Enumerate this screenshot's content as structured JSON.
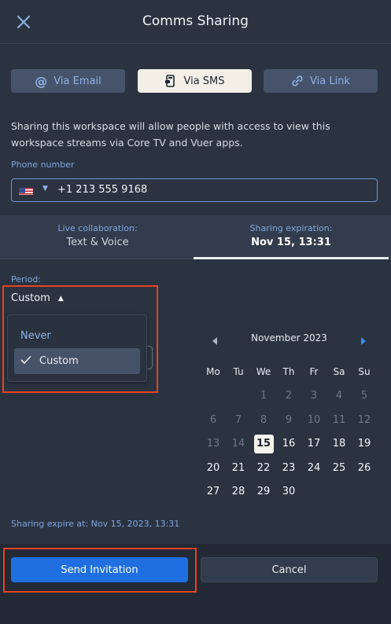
{
  "header": {
    "title": "Comms Sharing",
    "close_icon": "close-icon"
  },
  "via": {
    "email": {
      "label": "Via Email",
      "icon": "at-icon"
    },
    "sms": {
      "label": "Via SMS",
      "icon": "phone-icon",
      "active": true
    },
    "link": {
      "label": "Via Link",
      "icon": "link-icon"
    }
  },
  "description": "Sharing this workspace will allow people with access to view this workspace streams via Core TV and Vuer apps.",
  "phone": {
    "label": "Phone number",
    "value": "+1 213 555 9168",
    "country_icon": "us-flag-icon"
  },
  "tabs": {
    "live": {
      "label": "Live collaboration:",
      "value": "Text & Voice"
    },
    "expiration": {
      "label": "Sharing expiration:",
      "value": "Nov 15, 13:31",
      "active": true
    }
  },
  "period": {
    "label": "Period:",
    "selected": "Custom",
    "options": [
      {
        "label": "Never"
      },
      {
        "label": "Custom",
        "checked": true
      }
    ]
  },
  "calendar": {
    "month": "November 2023",
    "weekdays": [
      "Mo",
      "Tu",
      "We",
      "Th",
      "Fr",
      "Sa",
      "Su"
    ],
    "weeks": [
      [
        {
          "d": "",
          "dim": true
        },
        {
          "d": "",
          "dim": true
        },
        {
          "d": "1",
          "dim": true
        },
        {
          "d": "2",
          "dim": true
        },
        {
          "d": "3",
          "dim": true
        },
        {
          "d": "4",
          "dim": true
        },
        {
          "d": "5",
          "dim": true
        }
      ],
      [
        {
          "d": "6",
          "dim": true
        },
        {
          "d": "7",
          "dim": true
        },
        {
          "d": "8",
          "dim": true
        },
        {
          "d": "9",
          "dim": true
        },
        {
          "d": "10",
          "dim": true
        },
        {
          "d": "11",
          "dim": true
        },
        {
          "d": "12",
          "dim": true
        }
      ],
      [
        {
          "d": "13",
          "dim": true
        },
        {
          "d": "14",
          "dim": true
        },
        {
          "d": "15",
          "selected": true
        },
        {
          "d": "16"
        },
        {
          "d": "17"
        },
        {
          "d": "18"
        },
        {
          "d": "19"
        }
      ],
      [
        {
          "d": "20"
        },
        {
          "d": "21"
        },
        {
          "d": "22"
        },
        {
          "d": "23"
        },
        {
          "d": "24"
        },
        {
          "d": "25"
        },
        {
          "d": "26"
        }
      ],
      [
        {
          "d": "27"
        },
        {
          "d": "28"
        },
        {
          "d": "29"
        },
        {
          "d": "30"
        },
        {
          "d": ""
        },
        {
          "d": ""
        },
        {
          "d": ""
        }
      ]
    ]
  },
  "expire_note": "Sharing expire at: Nov 15, 2023, 13:31",
  "footer": {
    "send_label": "Send Invitation",
    "cancel_label": "Cancel"
  },
  "colors": {
    "background": "#2b3341",
    "accent": "#1f6fe0",
    "link": "#7fa6e0",
    "highlight": "#e8431f"
  }
}
